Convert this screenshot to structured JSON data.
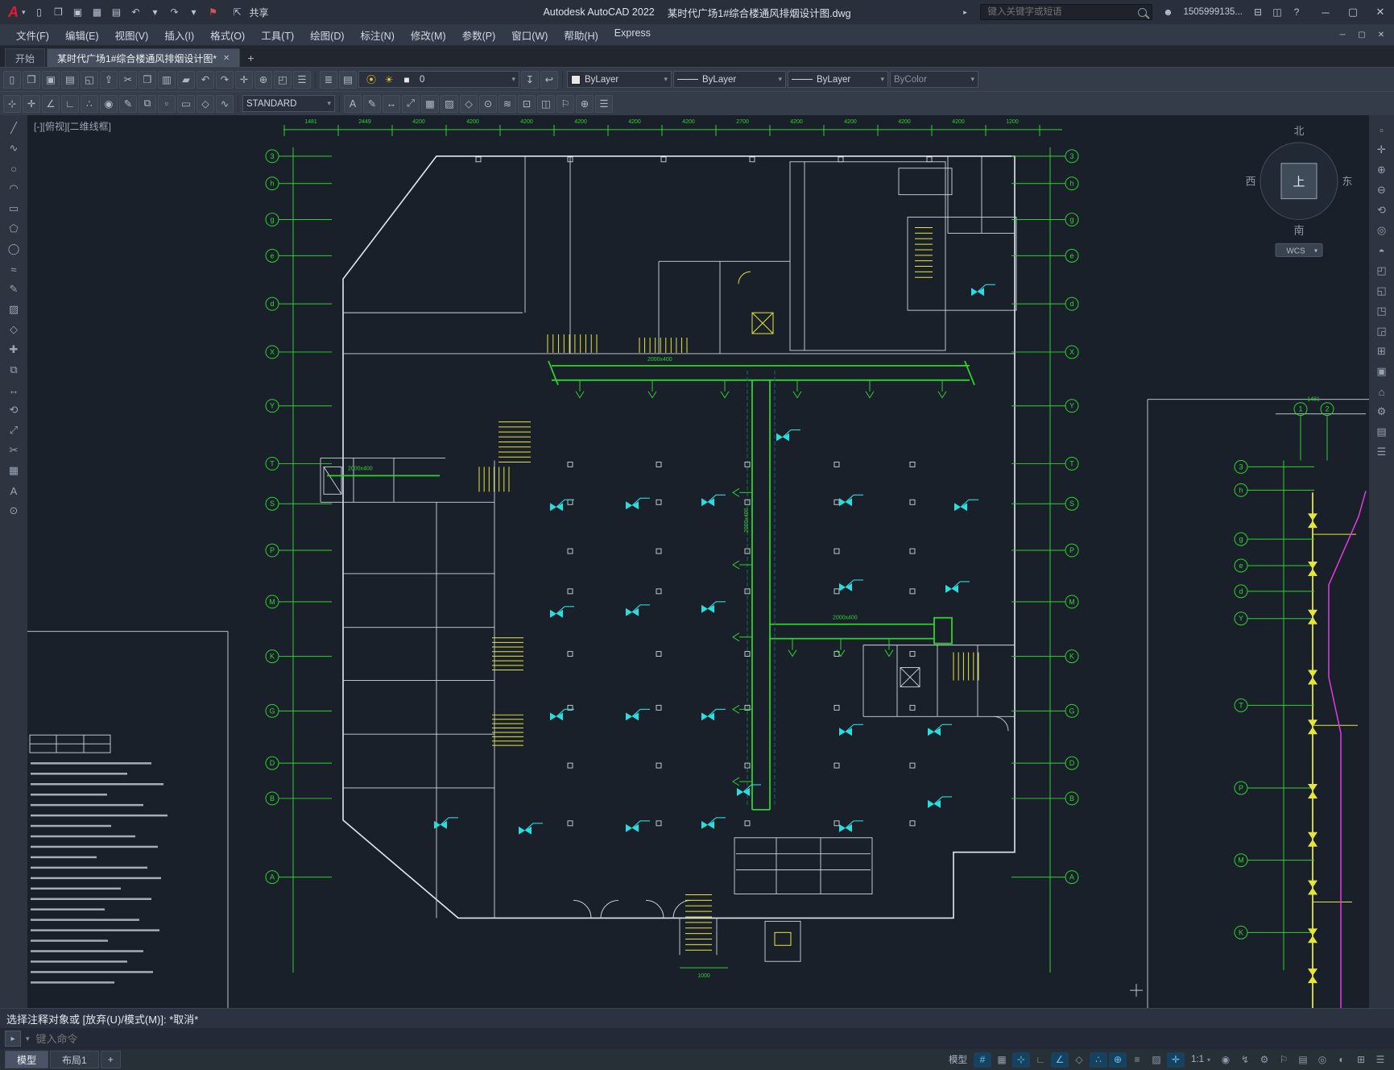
{
  "titlebar": {
    "app_logo": "A",
    "title_app": "Autodesk AutoCAD 2022",
    "title_doc": "某时代广场1#综合楼通风排烟设计图.dwg",
    "share_label": "共享",
    "search_placeholder": "键入关键字或短语",
    "account": "1505999135...",
    "qat": [
      {
        "name": "new-icon",
        "glyph": "▯"
      },
      {
        "name": "open-icon",
        "glyph": "❒"
      },
      {
        "name": "save-icon",
        "glyph": "▣"
      },
      {
        "name": "save-as-icon",
        "glyph": "▦"
      },
      {
        "name": "plot-icon",
        "glyph": "▤"
      },
      {
        "name": "undo-icon",
        "glyph": "↶"
      },
      {
        "name": "undo-caret-icon",
        "glyph": "▾"
      },
      {
        "name": "redo-icon",
        "glyph": "↷"
      },
      {
        "name": "redo-caret-icon",
        "glyph": "▾"
      },
      {
        "name": "customize-qat-icon",
        "glyph": "⚑",
        "color": "#d9534f"
      }
    ],
    "share_icon": {
      "name": "share-icon",
      "glyph": "⇪"
    },
    "right_icons": [
      {
        "name": "cart-icon",
        "glyph": "⊟"
      },
      {
        "name": "apps-icon",
        "glyph": "◫"
      },
      {
        "name": "help-icon",
        "glyph": "?"
      }
    ],
    "window_icons": [
      {
        "name": "window-minimize-icon",
        "glyph": "─"
      },
      {
        "name": "window-maximize-icon",
        "glyph": "▢"
      },
      {
        "name": "window-close-icon",
        "glyph": "✕"
      }
    ]
  },
  "menubar": {
    "items": [
      "文件(F)",
      "编辑(E)",
      "视图(V)",
      "插入(I)",
      "格式(O)",
      "工具(T)",
      "绘图(D)",
      "标注(N)",
      "修改(M)",
      "参数(P)",
      "窗口(W)",
      "帮助(H)",
      "Express"
    ],
    "window_icons": [
      {
        "name": "doc-minimize-icon",
        "glyph": "─"
      },
      {
        "name": "doc-restore-icon",
        "glyph": "▢"
      },
      {
        "name": "doc-close-icon",
        "glyph": "✕"
      }
    ]
  },
  "tabbar": {
    "start_tab": "开始",
    "doc_tab": "某时代广场1#综合楼通风排烟设计图*",
    "close_glyph": "✕",
    "new_tab": "+"
  },
  "toolbar1": {
    "icons_left": [
      {
        "name": "new-icon",
        "glyph": "▯"
      },
      {
        "name": "open-icon",
        "glyph": "❒"
      },
      {
        "name": "save-icon",
        "glyph": "▣"
      },
      {
        "name": "plot-icon",
        "glyph": "▤"
      },
      {
        "name": "plot-preview-icon",
        "glyph": "◱"
      },
      {
        "name": "publish-icon",
        "glyph": "⇪"
      },
      {
        "name": "cut-icon",
        "glyph": "✂"
      },
      {
        "name": "copy-icon",
        "glyph": "❐"
      },
      {
        "name": "paste-icon",
        "glyph": "▥"
      },
      {
        "name": "match-properties-icon",
        "glyph": "▰"
      },
      {
        "name": "undo-icon",
        "glyph": "↶"
      },
      {
        "name": "redo-icon",
        "glyph": "↷"
      },
      {
        "name": "pan-icon",
        "glyph": "✛"
      },
      {
        "name": "zoom-realtime-icon",
        "glyph": "⊕"
      },
      {
        "name": "zoom-window-icon",
        "glyph": "◰"
      },
      {
        "name": "properties-icon",
        "glyph": "☰"
      }
    ],
    "layer_icons": [
      {
        "name": "layer-properties-icon",
        "glyph": "≣"
      },
      {
        "name": "layer-states-icon",
        "glyph": "▤"
      }
    ],
    "layer_combo": {
      "status": [
        {
          "name": "layer-on-icon",
          "glyph": "⦿",
          "color": "#e8c832"
        },
        {
          "name": "layer-thaw-icon",
          "glyph": "☀",
          "color": "#e8c832"
        },
        {
          "name": "layer-color-swatch",
          "glyph": "■",
          "color": "#e8e8e8"
        }
      ],
      "value": "0"
    },
    "post_layer_icons": [
      {
        "name": "make-object-layer-current-icon",
        "glyph": "↧"
      },
      {
        "name": "layer-previous-icon",
        "glyph": "↩"
      }
    ],
    "color_combo": {
      "value": "ByLayer"
    },
    "linetype_combo": {
      "value": "ByLayer"
    },
    "lineweight_combo": {
      "value": "ByLayer"
    },
    "plotstyle_combo": {
      "value": "ByColor"
    }
  },
  "toolbar2": {
    "icons_left": [
      {
        "name": "osnap-icon",
        "glyph": "⊹"
      },
      {
        "name": "infer-icon",
        "glyph": "✛"
      },
      {
        "name": "polar-icon",
        "glyph": "∠"
      },
      {
        "name": "ortho-icon",
        "glyph": "∟"
      },
      {
        "name": "otrack-icon",
        "glyph": "∴"
      },
      {
        "name": "annotation-icon",
        "glyph": "◉"
      },
      {
        "name": "edit-icon",
        "glyph": "✎"
      },
      {
        "name": "copy-icon",
        "glyph": "⧉"
      },
      {
        "name": "region-icon",
        "glyph": "▫"
      },
      {
        "name": "rectangle-icon",
        "glyph": "▭"
      },
      {
        "name": "block-icon",
        "glyph": "◇"
      },
      {
        "name": "spline-icon",
        "glyph": "∿"
      }
    ],
    "style_combo": {
      "value": "STANDARD"
    },
    "icons_right": [
      {
        "name": "text-style-icon",
        "glyph": "A"
      },
      {
        "name": "edit-text-icon",
        "glyph": "✎"
      },
      {
        "name": "dimension-icon",
        "glyph": "↔"
      },
      {
        "name": "leader-icon",
        "glyph": "⤢"
      },
      {
        "name": "table-icon",
        "glyph": "▦"
      },
      {
        "name": "hatch-icon",
        "glyph": "▨"
      },
      {
        "name": "block-insert-icon",
        "glyph": "◇"
      },
      {
        "name": "point-style-icon",
        "glyph": "⊙"
      },
      {
        "name": "multiline-icon",
        "glyph": "≋"
      },
      {
        "name": "units-icon",
        "glyph": "⊡"
      },
      {
        "name": "designcenter-icon",
        "glyph": "◫"
      },
      {
        "name": "markup-icon",
        "glyph": "⚐"
      },
      {
        "name": "zoom-extents-icon",
        "glyph": "⊕"
      },
      {
        "name": "menu-icon",
        "glyph": "☰"
      }
    ]
  },
  "left_tools": [
    {
      "name": "line-icon",
      "glyph": "╱"
    },
    {
      "name": "polyline-icon",
      "glyph": "∿"
    },
    {
      "name": "circle-icon",
      "glyph": "○"
    },
    {
      "name": "arc-icon",
      "glyph": "◠"
    },
    {
      "name": "rectangle-icon",
      "glyph": "▭"
    },
    {
      "name": "polygon-icon",
      "glyph": "⬠"
    },
    {
      "name": "ellipse-icon",
      "glyph": "◯"
    },
    {
      "name": "spline-icon",
      "glyph": "≈"
    },
    {
      "name": "text-icon",
      "glyph": "✎"
    },
    {
      "name": "hatch-icon",
      "glyph": "▨"
    },
    {
      "name": "block-icon",
      "glyph": "◇"
    },
    {
      "name": "move-icon",
      "glyph": "✚"
    },
    {
      "name": "copy-icon",
      "glyph": "⧉"
    },
    {
      "name": "dimension-icon",
      "glyph": "↔"
    },
    {
      "name": "rotate-icon",
      "glyph": "⟲"
    },
    {
      "name": "scale-icon",
      "glyph": "⤢"
    },
    {
      "name": "trim-icon",
      "glyph": "✂"
    },
    {
      "name": "table-icon",
      "glyph": "▦"
    },
    {
      "name": "mtext-icon",
      "glyph": "A"
    },
    {
      "name": "point-icon",
      "glyph": "⊙"
    }
  ],
  "right_tools": [
    {
      "name": "fullscreen-icon",
      "glyph": "▫"
    },
    {
      "name": "pan-icon",
      "glyph": "✛"
    },
    {
      "name": "zoom-in-icon",
      "glyph": "⊕"
    },
    {
      "name": "zoom-out-icon",
      "glyph": "⊖"
    },
    {
      "name": "orbit-icon",
      "glyph": "⟲"
    },
    {
      "name": "steering-wheel-icon",
      "glyph": "◎"
    },
    {
      "name": "show-motion-icon",
      "glyph": "◓"
    },
    {
      "name": "view-top-icon",
      "glyph": "◰"
    },
    {
      "name": "view-front-icon",
      "glyph": "◱"
    },
    {
      "name": "view-side-icon",
      "glyph": "◳"
    },
    {
      "name": "view-iso-icon",
      "glyph": "◲"
    },
    {
      "name": "viewport-icon",
      "glyph": "⊞"
    },
    {
      "name": "named-views-icon",
      "glyph": "▣"
    },
    {
      "name": "home-view-icon",
      "glyph": "⌂"
    },
    {
      "name": "settings-icon",
      "glyph": "⚙"
    },
    {
      "name": "sheet-icon",
      "glyph": "▤"
    },
    {
      "name": "menu-icon",
      "glyph": "☰"
    }
  ],
  "command": {
    "history": "选择注释对象或 [放弃(U)/模式(M)]: *取消*",
    "badge": "▸",
    "caret": "▾",
    "placeholder": "键入命令"
  },
  "statusbar": {
    "model_tab": "模型",
    "layout_tab": "布局1",
    "new_layout": "+",
    "model_button": "模型",
    "scale": "1:1",
    "scale_caret": "▾",
    "icons_a": [
      {
        "name": "grid-icon",
        "glyph": "#",
        "active": true
      },
      {
        "name": "snap-icon",
        "glyph": "▦"
      },
      {
        "name": "infer-icon",
        "glyph": "⊹",
        "active": true
      },
      {
        "name": "ortho-icon",
        "glyph": "∟"
      },
      {
        "name": "polar-icon",
        "glyph": "∠",
        "active": true
      },
      {
        "name": "isodraft-icon",
        "glyph": "◇"
      },
      {
        "name": "otrack-icon",
        "glyph": "∴",
        "active": true
      },
      {
        "name": "osnap-icon",
        "glyph": "⊕",
        "active": true
      },
      {
        "name": "lineweight-icon",
        "glyph": "≡"
      },
      {
        "name": "transparency-icon",
        "glyph": "▨"
      },
      {
        "name": "dynamic-input-icon",
        "glyph": "✛",
        "active": true
      }
    ],
    "icons_b": [
      {
        "name": "annotation-visibility-icon",
        "glyph": "◉"
      },
      {
        "name": "annotation-autoscale-icon",
        "glyph": "↯"
      },
      {
        "name": "workspace-icon",
        "glyph": "⚙"
      },
      {
        "name": "annotation-monitor-icon",
        "glyph": "⚐"
      },
      {
        "name": "quick-properties-icon",
        "glyph": "▤"
      },
      {
        "name": "isolate-objects-icon",
        "glyph": "◎"
      },
      {
        "name": "hardware-accel-icon",
        "glyph": "◐"
      },
      {
        "name": "clean-screen-icon",
        "glyph": "⊞"
      },
      {
        "name": "customization-icon",
        "glyph": "☰"
      }
    ]
  },
  "drawing": {
    "viewport_label": "[-][俯视][二维线框]",
    "compass": {
      "north": "北",
      "south": "南",
      "east": "东",
      "west": "西",
      "center": "上",
      "wcs": "WCS"
    },
    "left_axis": [
      "3",
      "h",
      "g",
      "e",
      "d",
      "X",
      "Y",
      "T",
      "S",
      "P",
      "M",
      "K",
      "G",
      "D",
      "B",
      "A"
    ],
    "right_axis": [
      "3",
      "h",
      "g",
      "e",
      "d",
      "X",
      "Y",
      "T",
      "S",
      "P",
      "M",
      "K",
      "G",
      "D",
      "B",
      "A"
    ],
    "frag_axis": [
      "3",
      "h",
      "g",
      "e",
      "d",
      "Y",
      "T",
      "P",
      "M",
      "K"
    ],
    "frag_top": [
      "1",
      "2"
    ],
    "frag_dim": "1481",
    "top_dims": [
      "1481",
      "2449",
      "4200",
      "4200",
      "4200",
      "4200",
      "4200",
      "4200",
      "2700",
      "4200",
      "4200",
      "4200",
      "4200",
      "1200"
    ],
    "duct_labels": [
      "2000x400",
      "2000x400",
      "2000x400",
      "2000x400"
    ],
    "bottom_dim": "1000",
    "colors": {
      "axis": "#2fd12f",
      "walls": "#dfe4ea",
      "equipment": "#29dede",
      "stairs": "#e6e63a",
      "survey": "#e23ae2",
      "background": "#1a202a"
    }
  }
}
